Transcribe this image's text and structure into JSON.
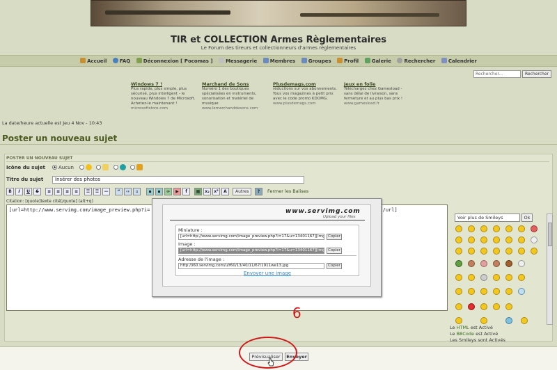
{
  "site": {
    "title": "TIR et COLLECTION Armes Règlementaires",
    "subtitle": "Le Forum des tireurs et collectionneurs d'armes règlementaires"
  },
  "nav": {
    "items": [
      {
        "label": "Accueil",
        "icon": "home-icon",
        "color": "#c89030"
      },
      {
        "label": "FAQ",
        "icon": "help-icon",
        "color": "#4a80c0"
      },
      {
        "label": "Déconnexion [ Pocomas ]",
        "icon": "logout-icon",
        "color": "#80a050"
      },
      {
        "label": "Messagerie",
        "icon": "mail-icon",
        "color": "#c0c0c0"
      },
      {
        "label": "Membres",
        "icon": "members-icon",
        "color": "#6a8ac0"
      },
      {
        "label": "Groupes",
        "icon": "groups-icon",
        "color": "#6a8ac0"
      },
      {
        "label": "Profil",
        "icon": "profile-icon",
        "color": "#c89030"
      },
      {
        "label": "Galerie",
        "icon": "gallery-icon",
        "color": "#60a060"
      },
      {
        "label": "Rechercher",
        "icon": "search-icon",
        "color": "#a0a0a0"
      },
      {
        "label": "Calendrier",
        "icon": "calendar-icon",
        "color": "#8090c0"
      }
    ]
  },
  "search": {
    "placeholder": "Rechercher...",
    "button": "Rechercher"
  },
  "ads": [
    {
      "title": "Windows 7 !",
      "text": "Plus rapide, plus simple, plus sécurisé, plus intelligent - le nouveau Windows 7 de Microsoft. Achetez-le maintenant !",
      "url": "microsoftstore.com"
    },
    {
      "title": "Marchand de Sons",
      "text": "Numéro 1 des boutiques spécialisées en instruments, sonorisation et matériel de musique",
      "url": "www.lemarchanddesons.com"
    },
    {
      "title": "Plusdemags.com",
      "text": "réductions sur vos abonnements. Tous vos magazines à petit prix avec le code promo KDOMG.",
      "url": "www.plusdemags.com"
    },
    {
      "title": "Jeux en folie",
      "text": "Téléchargez chez Gamesload - sans délai de livraison, sans fermeture et au plus bas prix !",
      "url": "www.gamesload.fr"
    }
  ],
  "datetime": "La date/heure actuelle est Jeu 4 Nov - 10:43",
  "page_title": "Poster un nouveau sujet",
  "form": {
    "section": "POSTER UN NOUVEAU SUJET",
    "icon_label": "Icône du sujet",
    "icon_none": "Aucun",
    "subject_label": "Titre du sujet",
    "subject_value": "Insérer des photos",
    "toolbar": {
      "bold": "B",
      "italic": "I",
      "underline": "U",
      "strike": "S",
      "others": "Autres",
      "close_tags": "Fermer les Balises"
    },
    "hint": "Citation: [quote]texte cité[/quote] (alt+q)",
    "editor_start": "[url=http://www.servimg.com/image_preview.php?i=",
    "editor_end": "g][/url]",
    "smiley_select": "Voir plus de Smileys",
    "smiley_ok": "Ok",
    "rules": {
      "html_link": "HTML",
      "html_text": "est Activé",
      "bbcode_link": "BBCode",
      "bbcode_text": "est Activé",
      "smileys": "Les Smileys sont Activés",
      "le": "Le",
      "la": "Le"
    }
  },
  "popup": {
    "logo": "www.servimg.com",
    "logo_sub": "Upload your files",
    "mini_label": "Miniature :",
    "mini_value": "[url=http://www.servimg.com/image_preview.php?i=17&u=13401167][img]",
    "image_label": "Image :",
    "image_value": "[url=http://www.servimg.com/image_preview.php?i=17&u=13401167][img]",
    "address_label": "Adresse de l'image :",
    "address_value": "http://i60.servimg.com/u/f60/13/40/11/67/1911we13.jpg",
    "copy": "Copier",
    "send_link": "Envoyer une image"
  },
  "annotation": "6",
  "buttons": {
    "preview": "Prévisualiser",
    "send": "Envoyer"
  }
}
